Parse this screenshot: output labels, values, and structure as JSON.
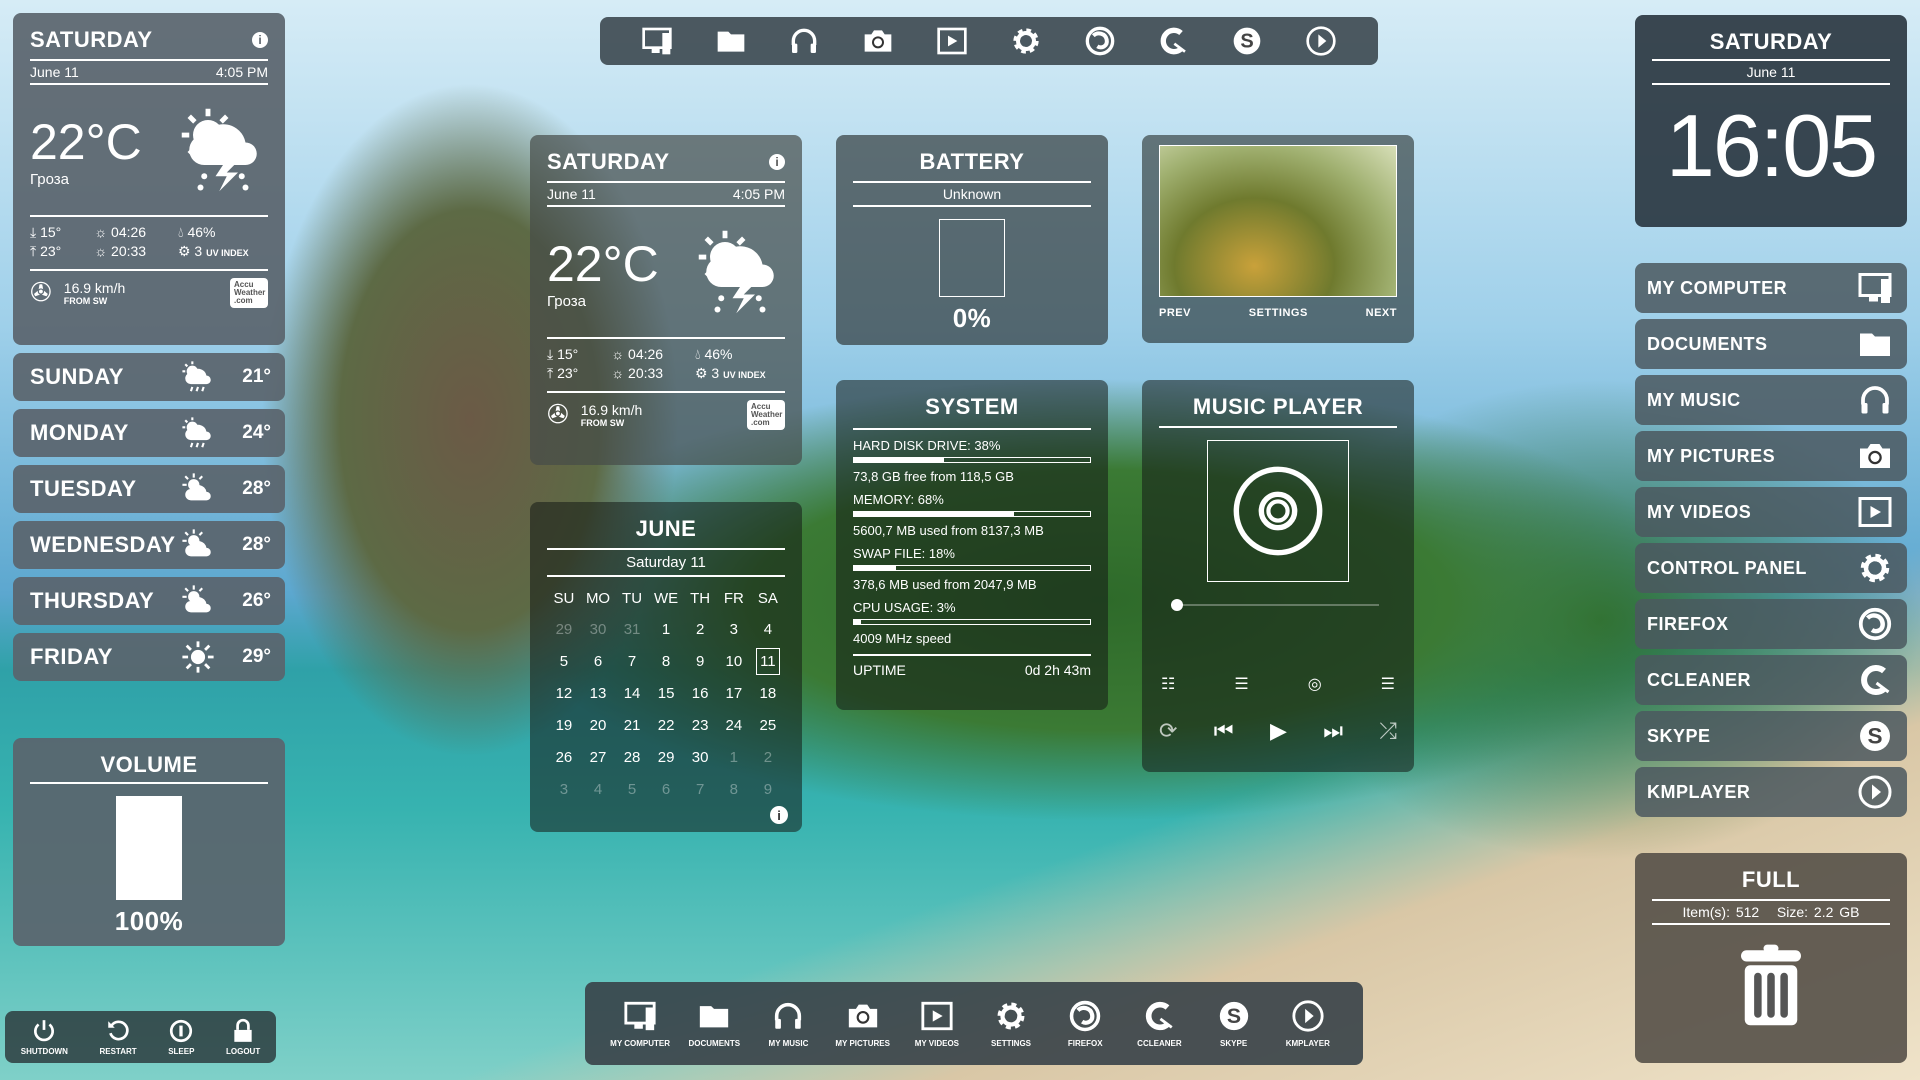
{
  "top_dock": {
    "items": [
      {
        "icon": "monitor-icon"
      },
      {
        "icon": "folder-icon"
      },
      {
        "icon": "headphones-icon"
      },
      {
        "icon": "camera-icon"
      },
      {
        "icon": "video-icon"
      },
      {
        "icon": "gear-icon"
      },
      {
        "icon": "firefox-icon"
      },
      {
        "icon": "ccleaner-icon"
      },
      {
        "icon": "skype-icon"
      },
      {
        "icon": "play-circle-icon"
      }
    ]
  },
  "bottom_dock": {
    "items": [
      {
        "icon": "monitor-icon",
        "label": "MY COMPUTER"
      },
      {
        "icon": "folder-icon",
        "label": "DOCUMENTS"
      },
      {
        "icon": "headphones-icon",
        "label": "MY MUSIC"
      },
      {
        "icon": "camera-icon",
        "label": "MY PICTURES"
      },
      {
        "icon": "video-icon",
        "label": "MY VIDEOS"
      },
      {
        "icon": "gear-icon",
        "label": "SETTINGS"
      },
      {
        "icon": "firefox-icon",
        "label": "FIREFOX"
      },
      {
        "icon": "ccleaner-icon",
        "label": "CCLEANER"
      },
      {
        "icon": "skype-icon",
        "label": "SKYPE"
      },
      {
        "icon": "play-circle-icon",
        "label": "KMPLAYER"
      }
    ]
  },
  "weather": {
    "day": "SATURDAY",
    "date": "June 11",
    "time": "4:05 PM",
    "temp": "22°C",
    "condition": "Гроза",
    "low": "15°",
    "high": "23°",
    "sunrise": "04:26",
    "sunset": "20:33",
    "humidity": "46%",
    "uv": "3",
    "uv_label": "UV INDEX",
    "wind": "16.9 km/h",
    "wind_dir": "FROM SW",
    "provider": "AccuWeather.com"
  },
  "forecast": [
    {
      "day": "SUNDAY",
      "temp": "21°",
      "icon": "cloud-sun-rain-icon"
    },
    {
      "day": "MONDAY",
      "temp": "24°",
      "icon": "cloud-sun-rain-icon"
    },
    {
      "day": "TUESDAY",
      "temp": "28°",
      "icon": "cloud-sun-icon"
    },
    {
      "day": "WEDNESDAY",
      "temp": "28°",
      "icon": "cloud-sun-icon"
    },
    {
      "day": "THURSDAY",
      "temp": "26°",
      "icon": "cloud-sun-icon"
    },
    {
      "day": "FRIDAY",
      "temp": "29°",
      "icon": "sun-icon"
    }
  ],
  "volume": {
    "title": "VOLUME",
    "level": 100,
    "label": "100%"
  },
  "power": [
    {
      "icon": "power-icon",
      "label": "SHUTDOWN"
    },
    {
      "icon": "restart-icon",
      "label": "RESTART"
    },
    {
      "icon": "sleep-icon",
      "label": "SLEEP"
    },
    {
      "icon": "lock-icon",
      "label": "LOGOUT"
    }
  ],
  "calendar": {
    "month": "JUNE",
    "subtitle": "Saturday 11",
    "weekdays": [
      "SU",
      "MO",
      "TU",
      "WE",
      "TH",
      "FR",
      "SA"
    ],
    "weeks": [
      [
        "29",
        "30",
        "31",
        "1",
        "2",
        "3",
        "4"
      ],
      [
        "5",
        "6",
        "7",
        "8",
        "9",
        "10",
        "11"
      ],
      [
        "12",
        "13",
        "14",
        "15",
        "16",
        "17",
        "18"
      ],
      [
        "19",
        "20",
        "21",
        "22",
        "23",
        "24",
        "25"
      ],
      [
        "26",
        "27",
        "28",
        "29",
        "30",
        "1",
        "2"
      ],
      [
        "3",
        "4",
        "5",
        "6",
        "7",
        "8",
        "9"
      ]
    ],
    "today": "11"
  },
  "battery": {
    "title": "BATTERY",
    "status": "Unknown",
    "level": 0,
    "label": "0%"
  },
  "system": {
    "title": "SYSTEM",
    "rows": [
      {
        "label": "HARD DISK DRIVE: 38%",
        "value": 38,
        "detail": "73,8 GB free from 118,5 GB"
      },
      {
        "label": "MEMORY: 68%",
        "value": 68,
        "detail": "5600,7 MB used from 8137,3 MB"
      },
      {
        "label": "SWAP FILE: 18%",
        "value": 18,
        "detail": "378,6 MB used from 2047,9 MB"
      },
      {
        "label": "CPU USAGE: 3%",
        "value": 3,
        "detail": "4009 MHz speed"
      }
    ],
    "uptime_label": "UPTIME",
    "uptime": "0d 2h 43m"
  },
  "photo": {
    "prev": "PREV",
    "settings": "SETTINGS",
    "next": "NEXT"
  },
  "music": {
    "title": "MUSIC PLAYER",
    "progress": 0
  },
  "clock": {
    "day": "SATURDAY",
    "date": "June 11",
    "time": "16:05"
  },
  "shortcuts": [
    {
      "label": "MY COMPUTER",
      "icon": "monitor-icon"
    },
    {
      "label": "DOCUMENTS",
      "icon": "folder-icon"
    },
    {
      "label": "MY MUSIC",
      "icon": "headphones-icon"
    },
    {
      "label": "MY PICTURES",
      "icon": "camera-icon"
    },
    {
      "label": "MY VIDEOS",
      "icon": "video-icon"
    },
    {
      "label": "CONTROL PANEL",
      "icon": "gear-icon"
    },
    {
      "label": "FIREFOX",
      "icon": "firefox-icon"
    },
    {
      "label": "CCLEANER",
      "icon": "ccleaner-icon"
    },
    {
      "label": "SKYPE",
      "icon": "skype-icon"
    },
    {
      "label": "KMPLAYER",
      "icon": "play-circle-icon"
    }
  ],
  "recycle": {
    "title": "FULL",
    "items": "Item(s): 512",
    "size": "Size: 2.2 GB"
  }
}
